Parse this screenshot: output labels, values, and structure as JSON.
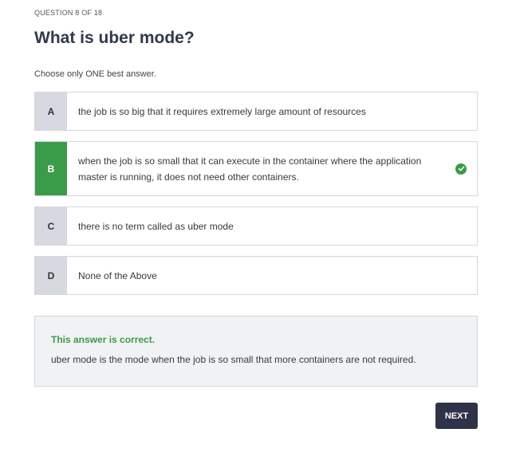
{
  "question": {
    "counter": "QUESTION 8 OF 18",
    "title": "What is uber mode?",
    "instruction": "Choose only ONE best answer."
  },
  "options": [
    {
      "letter": "A",
      "text": "the job is so big that it requires extremely large amount of resources",
      "selected": false
    },
    {
      "letter": "B",
      "text": "when the job is so small that it can execute in the container where the application master is running, it does not need other containers.",
      "selected": true,
      "correct_icon": "check-circle-icon"
    },
    {
      "letter": "C",
      "text": "there is no term called as uber mode",
      "selected": false
    },
    {
      "letter": "D",
      "text": "None of the Above",
      "selected": false
    }
  ],
  "feedback": {
    "title": "This answer is correct.",
    "text": "uber mode is the mode when the job is so small that more containers are not required."
  },
  "actions": {
    "next_label": "NEXT"
  },
  "colors": {
    "correct": "#3a9b48",
    "letter_bg": "#d6d9df",
    "button_bg": "#2f3349",
    "feedback_bg": "#f1f2f4"
  }
}
